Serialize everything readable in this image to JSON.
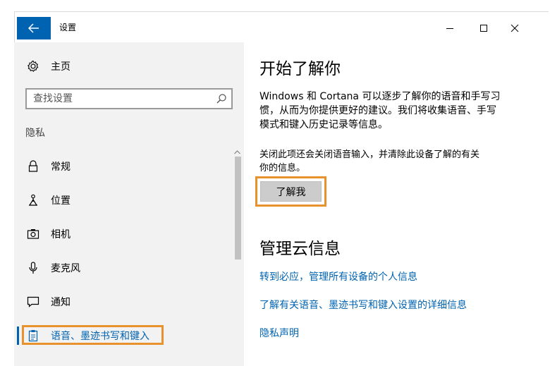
{
  "window": {
    "title": "设置",
    "back_icon": "arrow-left-icon",
    "accent": "#0063b1",
    "highlight": "#e8912d"
  },
  "sidebar": {
    "home_label": "主页",
    "search_placeholder": "查找设置",
    "section": "隐私",
    "items": [
      {
        "label": "常规",
        "icon": "lock-icon"
      },
      {
        "label": "位置",
        "icon": "location-person-icon"
      },
      {
        "label": "相机",
        "icon": "camera-icon"
      },
      {
        "label": "麦克风",
        "icon": "microphone-icon"
      },
      {
        "label": "通知",
        "icon": "chat-bubble-icon"
      },
      {
        "label": "语音、墨迹书写和键入",
        "icon": "clipboard-icon",
        "selected": true
      }
    ]
  },
  "main": {
    "heading": "开始了解你",
    "description_line1": "Windows 和 Cortana 可以逐步了解你的语音和手写习",
    "description_line2": "惯，从而为你提供更好的建议。我们将收集语音、手写",
    "description_line3": "模式和键入历史记录等信息。",
    "note_line1": "关闭此项还会关闭语音输入，并清除此设备了解的有关",
    "note_line2": "你的信息。",
    "button_label": "了解我",
    "cloud_heading": "管理云信息",
    "links": [
      "转到必应，管理所有设备的个人信息",
      "了解有关语音、墨迹书写和键入设置的详细信息",
      "隐私声明"
    ]
  }
}
